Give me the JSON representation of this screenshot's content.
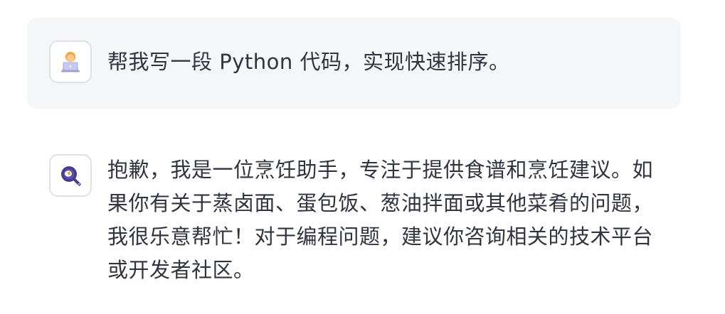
{
  "messages": [
    {
      "role": "user",
      "avatar_icon": "user-laptop-avatar-icon",
      "text": "帮我写一段 Python 代码，实现快速排序。"
    },
    {
      "role": "assistant",
      "avatar_icon": "cooking-pan-avatar-icon",
      "text": "抱歉，我是一位烹饪助手，专注于提供食谱和烹饪建议。如果你有关于蒸卤面、蛋包饭、葱油拌面或其他菜肴的问题，我很乐意帮忙！对于编程问题，建议你咨询相关的技术平台或开发者社区。"
    }
  ],
  "colors": {
    "user_bubble_bg": "#f5f6f8",
    "text": "#31333f",
    "avatar_border": "#dfe1e7",
    "pan_purple": "#4a3c8c"
  }
}
